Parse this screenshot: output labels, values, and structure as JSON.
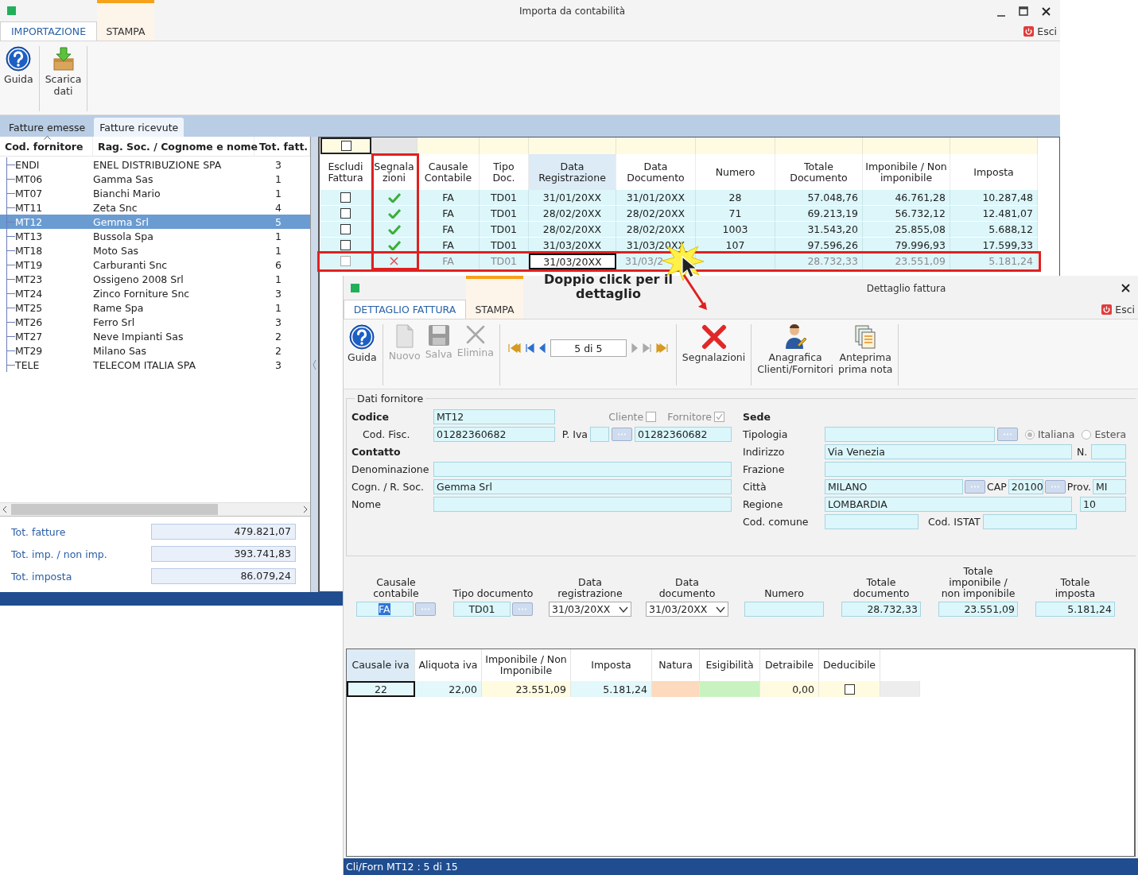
{
  "window": {
    "title": "Importa da contabilità",
    "exit": "Esci"
  },
  "ribbon_tabs": [
    {
      "label": "IMPORTAZIONE",
      "selected": true
    },
    {
      "label": "STAMPA",
      "selected": false
    }
  ],
  "toolbar": [
    {
      "kind": "help",
      "label": "Guida"
    },
    {
      "kind": "download",
      "label": "Scarica\ndati"
    }
  ],
  "doc_tabs": [
    {
      "label": "Fatture emesse",
      "selected": false
    },
    {
      "label": "Fatture ricevute",
      "selected": true
    }
  ],
  "suppliers": {
    "columns": [
      {
        "label": "Cod. fornitore",
        "sorted": true
      },
      {
        "label": "Rag. Soc. / Cognome e nome",
        "sorted": false
      },
      {
        "label": "Tot. fatt.",
        "sorted": false
      }
    ],
    "rows": [
      {
        "code": "ENDI",
        "name": "ENEL DISTRIBUZIONE SPA",
        "count": "3",
        "selected": false
      },
      {
        "code": "MT06",
        "name": "Gamma Sas",
        "count": "1",
        "selected": false
      },
      {
        "code": "MT07",
        "name": "Bianchi Mario",
        "count": "1",
        "selected": false
      },
      {
        "code": "MT11",
        "name": "Zeta Snc",
        "count": "4",
        "selected": false
      },
      {
        "code": "MT12",
        "name": "Gemma Srl",
        "count": "5",
        "selected": true
      },
      {
        "code": "MT13",
        "name": "Bussola Spa",
        "count": "1",
        "selected": false
      },
      {
        "code": "MT18",
        "name": "Moto Sas",
        "count": "1",
        "selected": false
      },
      {
        "code": "MT19",
        "name": "Carburanti Snc",
        "count": "6",
        "selected": false
      },
      {
        "code": "MT23",
        "name": "Ossigeno 2008 Srl",
        "count": "1",
        "selected": false
      },
      {
        "code": "MT24",
        "name": "Zinco Forniture Snc",
        "count": "3",
        "selected": false
      },
      {
        "code": "MT25",
        "name": "Rame Spa",
        "count": "1",
        "selected": false
      },
      {
        "code": "MT26",
        "name": "Ferro Srl",
        "count": "3",
        "selected": false
      },
      {
        "code": "MT27",
        "name": "Neve Impianti Sas",
        "count": "2",
        "selected": false
      },
      {
        "code": "MT29",
        "name": "Milano Sas",
        "count": "2",
        "selected": false
      },
      {
        "code": "TELE",
        "name": "TELECOM ITALIA SPA",
        "count": "3",
        "selected": false
      }
    ]
  },
  "totals": [
    {
      "label": "Tot. fatture",
      "value": "479.821,07"
    },
    {
      "label": "Tot. imp. / non imp.",
      "value": "393.741,83"
    },
    {
      "label": "Tot. imposta",
      "value": "86.079,24"
    }
  ],
  "invoices": {
    "filter_checked": false,
    "columns": [
      {
        "label": "Escludi\nFattura",
        "sorted": false
      },
      {
        "label": "Segnala\nzioni",
        "sorted": false
      },
      {
        "label": "Causale\nContabile",
        "sorted": false
      },
      {
        "label": "Tipo\nDoc.",
        "sorted": false
      },
      {
        "label": "Data\nRegistrazione",
        "sorted": true
      },
      {
        "label": "Data\nDocumento",
        "sorted": false
      },
      {
        "label": "Numero",
        "sorted": false
      },
      {
        "label": "Totale\nDocumento",
        "sorted": false
      },
      {
        "label": "Imponibile / Non\nimponibile",
        "sorted": false
      },
      {
        "label": "Imposta",
        "sorted": false
      }
    ],
    "rows": [
      {
        "excluded": false,
        "flagged": false,
        "causale": "FA",
        "tipo": "TD01",
        "data_reg": "31/01/20XX",
        "data_doc": "31/01/20XX",
        "numero": "28",
        "totale": "57.048,76",
        "imponibile": "46.761,28",
        "imposta": "10.287,48"
      },
      {
        "excluded": false,
        "flagged": false,
        "causale": "FA",
        "tipo": "TD01",
        "data_reg": "28/02/20XX",
        "data_doc": "28/02/20XX",
        "numero": "71",
        "totale": "69.213,19",
        "imponibile": "56.732,12",
        "imposta": "12.481,07"
      },
      {
        "excluded": false,
        "flagged": false,
        "causale": "FA",
        "tipo": "TD01",
        "data_reg": "28/02/20XX",
        "data_doc": "28/02/20XX",
        "numero": "1003",
        "totale": "31.543,20",
        "imponibile": "25.855,08",
        "imposta": "5.688,12"
      },
      {
        "excluded": false,
        "flagged": false,
        "causale": "FA",
        "tipo": "TD01",
        "data_reg": "31/03/20XX",
        "data_doc": "31/03/20XX",
        "numero": "107",
        "totale": "97.596,26",
        "imponibile": "79.996,93",
        "imposta": "17.599,33"
      },
      {
        "excluded": false,
        "flagged": true,
        "causale": "FA",
        "tipo": "TD01",
        "data_reg": "31/03/20XX",
        "data_doc": "31/03/2",
        "totale": "28.732,33",
        "imponibile": "23.551,09",
        "imposta": "5.181,24"
      }
    ]
  },
  "annotation": {
    "text": "Doppio click per il\ndettaglio"
  },
  "detail": {
    "title": "Dettaglio fattura",
    "exit": "Esci",
    "tabs": [
      {
        "label": "DETTAGLIO FATTURA",
        "selected": true
      },
      {
        "label": "STAMPA",
        "selected": false
      }
    ],
    "toolbar": [
      {
        "kind": "help",
        "label": "Guida",
        "disabled": false
      },
      {
        "kind": "new",
        "label": "Nuovo",
        "disabled": true
      },
      {
        "kind": "save",
        "label": "Salva",
        "disabled": true
      },
      {
        "kind": "delete",
        "label": "Elimina",
        "disabled": true
      },
      {
        "kind": "navigator",
        "counter": "5 di 5"
      },
      {
        "kind": "warnings",
        "label": "Segnalazioni",
        "disabled": false
      },
      {
        "kind": "registry",
        "label": "Anagrafica\nClienti/Fornitori",
        "disabled": false
      },
      {
        "kind": "preview",
        "label": "Anteprima\nprima nota",
        "disabled": false
      }
    ],
    "supplier": {
      "title": "Dati fornitore",
      "codice": {
        "label": "Codice",
        "value": "MT12"
      },
      "cliente": {
        "label": "Cliente",
        "checked": false
      },
      "fornitore": {
        "label": "Fornitore",
        "checked": true
      },
      "cod_fisc": {
        "label": "Cod. Fisc.",
        "value": "01282360682"
      },
      "p_iva": {
        "label": "P. Iva",
        "value": "01282360682"
      },
      "contatto": {
        "label": "Contatto"
      },
      "denominazione": {
        "label": "Denominazione"
      },
      "cognome": {
        "label": "Cogn. / R. Soc.",
        "value": "Gemma Srl"
      },
      "nome": {
        "label": "Nome"
      },
      "sede": {
        "label": "Sede"
      },
      "tipologia": {
        "label": "Tipologia"
      },
      "origine": [
        {
          "label": "Italiana",
          "selected": true
        },
        {
          "label": "Estera",
          "selected": false
        }
      ],
      "indirizzo": {
        "label": "Indirizzo",
        "value": "Via Venezia"
      },
      "civico": {
        "label": "N."
      },
      "frazione": {
        "label": "Frazione"
      },
      "citta": {
        "label": "Città",
        "value": "MILANO"
      },
      "cap": {
        "label": "CAP",
        "value": "20100"
      },
      "prov": {
        "label": "Prov.",
        "value": "MI"
      },
      "regione": {
        "label": "Regione",
        "value": "LOMBARDIA",
        "code": "10"
      },
      "cod_comune": {
        "label": "Cod. comune"
      },
      "cod_istat": {
        "label": "Cod. ISTAT"
      }
    },
    "document_fields": [
      {
        "label": "Causale\ncontabile",
        "value": "FA",
        "kind": "lookup",
        "focused": true
      },
      {
        "label": "Tipo documento",
        "value": "TD01",
        "kind": "lookup",
        "focused": false
      },
      {
        "label": "Data\nregistrazione",
        "value": "31/03/20XX",
        "kind": "date",
        "focused": false
      },
      {
        "label": "Data\ndocumento",
        "value": "31/03/20XX",
        "kind": "date",
        "focused": false
      },
      {
        "label": "Numero",
        "kind": "text",
        "focused": false
      },
      {
        "label": "Totale\ndocumento",
        "value": "28.732,33",
        "kind": "amount",
        "focused": false
      },
      {
        "label": "Totale\nimponibile /\nnon imponibile",
        "value": "23.551,09",
        "kind": "amount",
        "focused": false
      },
      {
        "label": "Totale\nimposta",
        "value": "5.181,24",
        "kind": "amount",
        "focused": false
      }
    ],
    "vat_lines": {
      "columns": [
        "Causale iva",
        "Aliquota iva",
        "Imponibile / Non\nImponibile",
        "Imposta",
        "Natura",
        "Esigibilità",
        "Detraibile",
        "Deducibile"
      ],
      "rows": [
        {
          "causale": "22",
          "aliquota": "22,00",
          "imponibile": "23.551,09",
          "imposta": "5.181,24",
          "detraibile": "0,00",
          "deducibile": false
        }
      ]
    },
    "status": "Cli/Forn MT12 : 5 di 15"
  }
}
